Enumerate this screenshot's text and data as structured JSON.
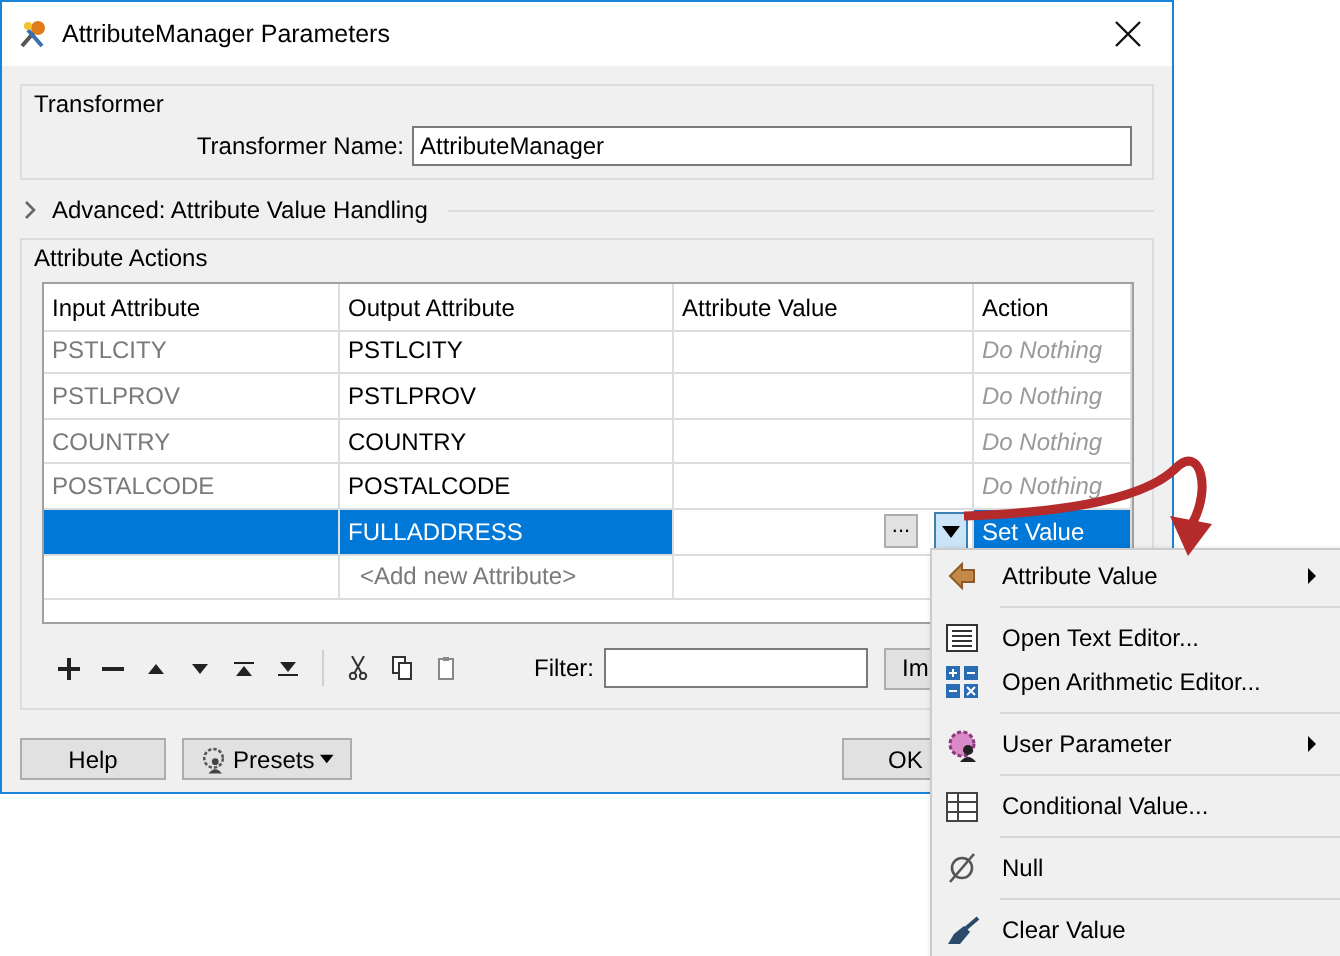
{
  "window": {
    "title": "AttributeManager Parameters"
  },
  "transformer": {
    "group_label": "Transformer",
    "name_label": "Transformer Name:",
    "name_value": "AttributeManager"
  },
  "advanced": {
    "label": "Advanced: Attribute Value Handling",
    "expanded": false
  },
  "attribute_actions": {
    "group_label": "Attribute Actions",
    "columns": [
      "Input Attribute",
      "Output Attribute",
      "Attribute Value",
      "Action"
    ],
    "rows": [
      {
        "input": "PSTLCITY",
        "output": "PSTLCITY",
        "action": "Do Nothing",
        "action_default": true,
        "selected": false
      },
      {
        "input": "PSTLPROV",
        "output": "PSTLPROV",
        "action": "Do Nothing",
        "action_default": true,
        "selected": false
      },
      {
        "input": "COUNTRY",
        "output": "COUNTRY",
        "action": "Do Nothing",
        "action_default": true,
        "selected": false
      },
      {
        "input": "POSTALCODE",
        "output": "POSTALCODE",
        "action": "Do Nothing",
        "action_default": true,
        "selected": false
      },
      {
        "output": "FULLADDRESS",
        "value_button": "...",
        "action": "Set Value",
        "action_default": false,
        "selected": true
      }
    ],
    "add_row_placeholder": "<Add new Attribute>",
    "filter_label": "Filter:",
    "import_button": "Im"
  },
  "buttons": {
    "help": "Help",
    "presets": "Presets",
    "ok": "OK"
  },
  "menu": [
    {
      "kind": "attribute",
      "label": "Attribute Value",
      "submenu": true
    },
    {
      "kind": "separator"
    },
    {
      "kind": "text",
      "label": "Open Text Editor...",
      "submenu": false
    },
    {
      "kind": "arithmetic",
      "label": "Open Arithmetic Editor...",
      "submenu": false
    },
    {
      "kind": "separator"
    },
    {
      "kind": "parameter",
      "label": "User Parameter",
      "submenu": true
    },
    {
      "kind": "separator"
    },
    {
      "kind": "conditional",
      "label": "Conditional Value...",
      "submenu": false
    },
    {
      "kind": "separator"
    },
    {
      "kind": "null",
      "label": "Null",
      "submenu": false
    },
    {
      "kind": "separator"
    },
    {
      "kind": "clear",
      "label": "Clear Value",
      "submenu": false
    }
  ]
}
